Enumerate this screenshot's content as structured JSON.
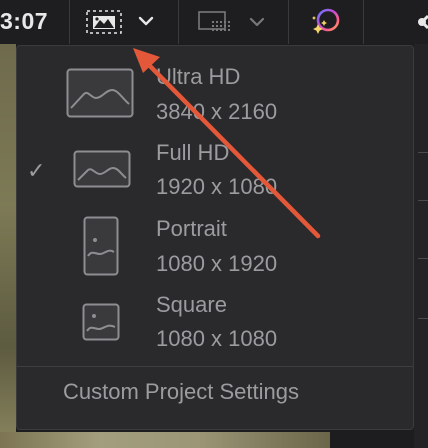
{
  "toolbar": {
    "timecode": "3:07",
    "aspect_button_icon": "landscape-aspect-icon",
    "viewer_layout_icon": "viewer-layout-icon",
    "color_fx_icon": "magic-color-icon"
  },
  "menu": {
    "items": [
      {
        "name": "Ultra HD",
        "resolution": "3840 x 2160",
        "icon": "landscape-large-icon",
        "checked": false
      },
      {
        "name": "Full HD",
        "resolution": "1920 x 1080",
        "icon": "landscape-icon",
        "checked": true
      },
      {
        "name": "Portrait",
        "resolution": "1080 x 1920",
        "icon": "portrait-icon",
        "checked": false
      },
      {
        "name": "Square",
        "resolution": "1080 x 1080",
        "icon": "square-icon",
        "checked": false
      }
    ],
    "check_mark": "✓",
    "custom_settings_label": "Custom Project Settings"
  },
  "colors": {
    "menu_bg": "#2a2a2c",
    "text": "#9c9ca0",
    "annotation_arrow": "#e4583a"
  }
}
